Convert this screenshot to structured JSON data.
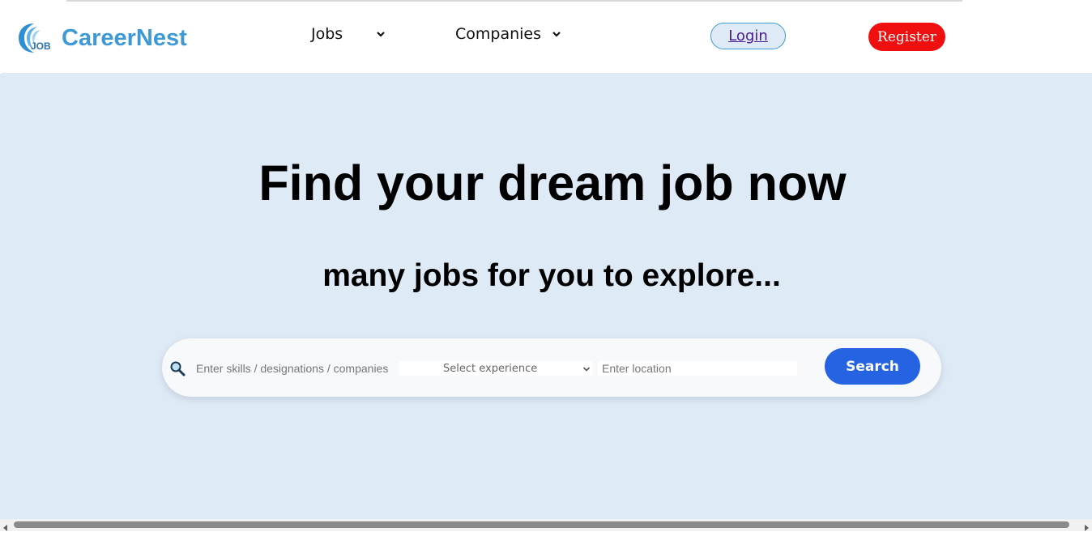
{
  "brand": {
    "logo_text": "JOB",
    "name": "CareerNest",
    "color": "#3d9ad6"
  },
  "nav": {
    "jobs_label": "Jobs",
    "companies_label": "Companies",
    "login_label": "Login",
    "register_label": "Register"
  },
  "hero": {
    "title": "Find your dream job now",
    "subtitle": "many jobs for you to explore...",
    "background": "#dfeaf7"
  },
  "search": {
    "skills_placeholder": "Enter skills / designations / companies",
    "experience_selected": "Select experience",
    "location_placeholder": "Enter location",
    "button_label": "Search",
    "button_color": "#2563e2"
  },
  "colors": {
    "register": "#f00f0f",
    "login_border": "#3d9ad6",
    "login_text": "#4b1a8e"
  }
}
